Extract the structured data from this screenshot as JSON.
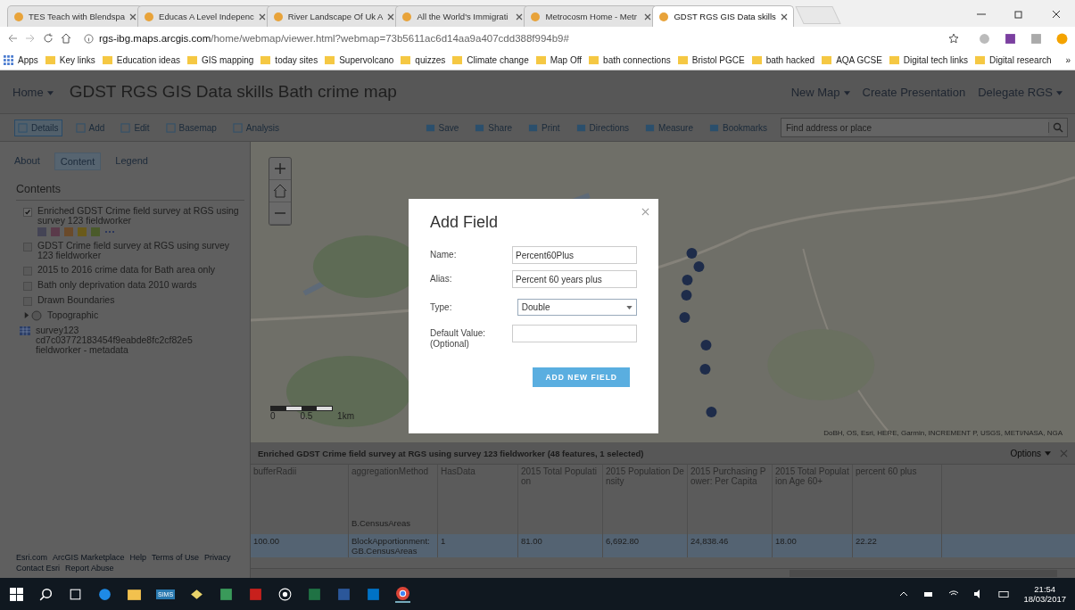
{
  "browser": {
    "tabs": [
      {
        "title": "TES Teach with Blendspa",
        "selected": false
      },
      {
        "title": "Educas A Level Indepenc",
        "selected": false
      },
      {
        "title": "River Landscape Of Uk A",
        "selected": false
      },
      {
        "title": "All the World's Immigrati",
        "selected": false
      },
      {
        "title": "Metrocosm Home - Metr",
        "selected": false
      },
      {
        "title": "GDST RGS GIS Data skills",
        "selected": true
      }
    ],
    "url_host": "rgs-ibg.maps.arcgis.com",
    "url_path": "/home/webmap/viewer.html?webmap=73b5611ac6d14aa9a407cdd388f994b9#",
    "bookmarks": [
      "Apps",
      "Key links",
      "Education ideas",
      "GIS mapping",
      "today sites",
      "Supervolcano",
      "quizzes",
      "Climate change",
      "Map Off",
      "bath connections",
      "Bristol PGCE",
      "bath hacked",
      "AQA GCSE",
      "Digital tech links",
      "Digital research"
    ],
    "more": "»"
  },
  "header": {
    "home": "Home",
    "title": "GDST RGS GIS Data skills Bath crime map",
    "links": [
      "New Map",
      "Create Presentation",
      "Delegate RGS"
    ]
  },
  "toolbar": {
    "left": [
      {
        "label": "Details",
        "selected": true
      },
      {
        "label": "Add",
        "selected": false
      },
      {
        "label": "Edit",
        "selected": false
      },
      {
        "label": "Basemap",
        "selected": false
      },
      {
        "label": "Analysis",
        "selected": false
      }
    ],
    "right": [
      "Save",
      "Share",
      "Print",
      "Directions",
      "Measure",
      "Bookmarks"
    ],
    "search_placeholder": "Find address or place"
  },
  "sidebar": {
    "tabs": [
      {
        "label": "About",
        "selected": false
      },
      {
        "label": "Content",
        "selected": true
      },
      {
        "label": "Legend",
        "selected": false
      }
    ],
    "heading": "Contents",
    "layers": [
      {
        "kind": "layer",
        "label": "Enriched GDST Crime field survey at RGS using survey 123 fieldworker",
        "checked": true
      },
      {
        "kind": "layer",
        "label": "GDST Crime field survey at RGS using survey 123 fieldworker",
        "checked": false
      },
      {
        "kind": "layer",
        "label": "2015 to 2016 crime data for Bath area only",
        "checked": false
      },
      {
        "kind": "layer",
        "label": "Bath only deprivation data 2010 wards",
        "checked": false
      },
      {
        "kind": "layer",
        "label": "Drawn Boundaries",
        "checked": false
      },
      {
        "kind": "basemap",
        "label": "Topographic",
        "expanded": false
      },
      {
        "kind": "table",
        "label": "survey123 cd7c03772183454f9eabde8fc2cf82e5 fieldworker - metadata"
      }
    ],
    "footer_links": [
      "Esri.com",
      "ArcGIS Marketplace",
      "Help",
      "Terms of Use",
      "Privacy",
      "Contact Esri",
      "Report Abuse"
    ]
  },
  "map": {
    "scale_labels": [
      "0",
      "0.5",
      "1km"
    ],
    "attribution": "DoBH, OS, Esri, HERE, Garmin, INCREMENT P, USGS, METI/NASA, NGA"
  },
  "dialog": {
    "title": "Add Field",
    "fields": [
      {
        "kind": "text",
        "label": "Name:",
        "value": "Percent60Plus"
      },
      {
        "kind": "text",
        "label": "Alias:",
        "value": "Percent 60 years plus"
      },
      {
        "kind": "select",
        "label": "Type:",
        "value": "Double"
      },
      {
        "kind": "text",
        "label": "Default Value: (Optional)"
      }
    ],
    "button": "ADD NEW FIELD"
  },
  "table": {
    "title": "Enriched GDST Crime field survey at RGS using survey 123 fieldworker (48 features, 1 selected)",
    "options": "Options",
    "columns": [
      "bufferRadii",
      "aggregationMethod",
      "HasData",
      "2015 Total Population",
      "2015 Population Density",
      "2015 Purchasing Power: Per Capita",
      "2015 Total Population Age 60+",
      "percent 60 plus"
    ],
    "rows": [
      {
        "selected": false,
        "cells": [
          null,
          "B.CensusAreas",
          null,
          null,
          null,
          null,
          null,
          null
        ]
      },
      {
        "selected": true,
        "cells": [
          "100.00",
          "BlockApportionment:GB.CensusAreas",
          "1",
          "81.00",
          "6,692.80",
          "24,838.46",
          "18.00",
          "22.22"
        ]
      }
    ]
  },
  "taskbar": {
    "sims_label": "SIMS",
    "time": "21:54",
    "date": "18/03/2017"
  }
}
